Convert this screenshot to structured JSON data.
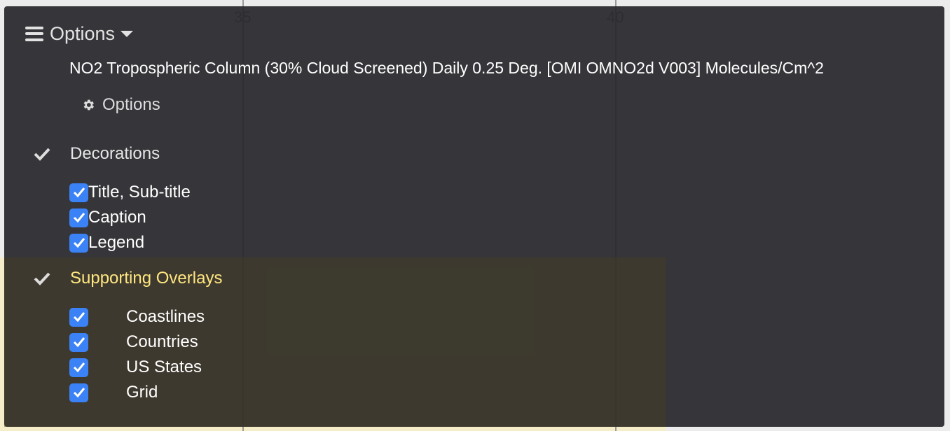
{
  "map": {
    "tick_labels": [
      "35",
      "40"
    ]
  },
  "header": {
    "options_label": "Options",
    "menu_icon": "menu-icon",
    "caret_icon": "chevron-down-icon"
  },
  "layer": {
    "title": "NO2 Tropospheric Column (30% Cloud Screened) Daily 0.25 Deg. [OMI OMNO2d V003] Molecules/Cm^2"
  },
  "layer_options": {
    "label": "Options",
    "icon": "gear-icon"
  },
  "decorations": {
    "label": "Decorations",
    "items": [
      {
        "label": "Title, Sub-title",
        "checked": true
      },
      {
        "label": "Caption",
        "checked": true
      },
      {
        "label": "Legend",
        "checked": true
      }
    ]
  },
  "overlays": {
    "label": "Supporting Overlays",
    "highlight_color": "#ffe680",
    "items": [
      {
        "label": "Coastlines",
        "checked": true
      },
      {
        "label": "Countries",
        "checked": true
      },
      {
        "label": "US States",
        "checked": true
      },
      {
        "label": "Grid",
        "checked": true
      }
    ]
  },
  "colors": {
    "panel_bg": "#2a2a2e",
    "checkbox_accent": "#3b82f6"
  }
}
